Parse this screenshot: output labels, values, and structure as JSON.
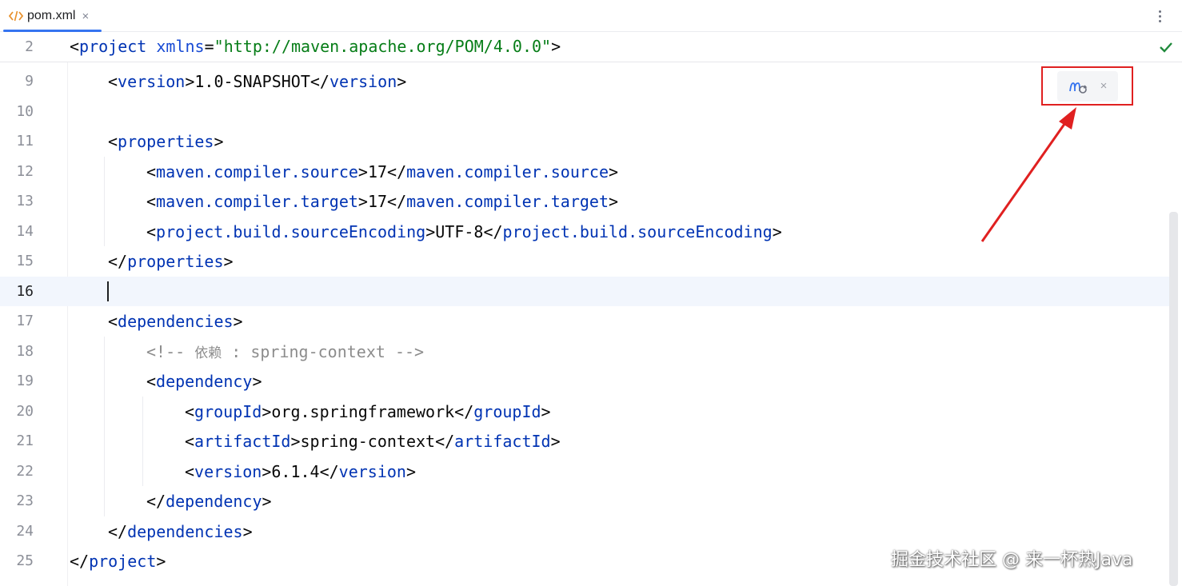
{
  "tab": {
    "filename": "pom.xml",
    "close": "×",
    "icon": "xml-file-icon"
  },
  "toolbar": {
    "more_icon": "vertical-ellipsis-icon",
    "status_icon": "green-check-icon"
  },
  "sticky_line": {
    "number": "2",
    "open": "<",
    "tag": "project",
    "attr": "xmlns",
    "eq": "=",
    "value": "\"http://maven.apache.org/POM/4.0.0\"",
    "close": ">"
  },
  "lines": [
    {
      "n": "9",
      "a": "<",
      "t1": "version",
      "b": ">1.0-SNAPSHOT</",
      "t2": "version",
      "c": ">"
    },
    {
      "n": "10"
    },
    {
      "n": "11",
      "a": "<",
      "t1": "properties",
      "b": ">"
    },
    {
      "n": "12",
      "a": "<",
      "t1": "maven.compiler.source",
      "b": ">17</",
      "t2": "maven.compiler.source",
      "c": ">"
    },
    {
      "n": "13",
      "a": "<",
      "t1": "maven.compiler.target",
      "b": ">17</",
      "t2": "maven.compiler.target",
      "c": ">"
    },
    {
      "n": "14",
      "a": "<",
      "t1": "project.build.sourceEncoding",
      "b": ">UTF-8</",
      "t2": "project.build.sourceEncoding",
      "c": ">"
    },
    {
      "n": "15",
      "a": "</",
      "t1": "properties",
      "b": ">"
    },
    {
      "n": "16"
    },
    {
      "n": "17",
      "a": "<",
      "t1": "dependencies",
      "b": ">"
    },
    {
      "n": "18",
      "comment_start": "<!-- ",
      "comment_cjk": "依赖",
      "comment_end": " : spring-context -->"
    },
    {
      "n": "19",
      "a": "<",
      "t1": "dependency",
      "b": ">"
    },
    {
      "n": "20",
      "a": "<",
      "t1": "groupId",
      "b": ">org.springframework</",
      "t2": "groupId",
      "c": ">"
    },
    {
      "n": "21",
      "a": "<",
      "t1": "artifactId",
      "b": ">spring-context</",
      "t2": "artifactId",
      "c": ">"
    },
    {
      "n": "22",
      "a": "<",
      "t1": "version",
      "b": ">6.1.4</",
      "t2": "version",
      "c": ">"
    },
    {
      "n": "23",
      "a": "</",
      "t1": "dependency",
      "b": ">"
    },
    {
      "n": "24",
      "a": "</",
      "t1": "dependencies",
      "b": ">"
    },
    {
      "n": "25",
      "a": "</",
      "t1": "project",
      "b": ">"
    }
  ],
  "maven_popup": {
    "reload_icon": "maven-reload-icon",
    "close": "×"
  },
  "watermark": "掘金技术社区 @ 来一杯热Java",
  "colors": {
    "tag": "#0033b3",
    "string": "#067d17",
    "comment": "#8c8c8c",
    "accent": "#3574f0",
    "annotation": "#e02020"
  }
}
